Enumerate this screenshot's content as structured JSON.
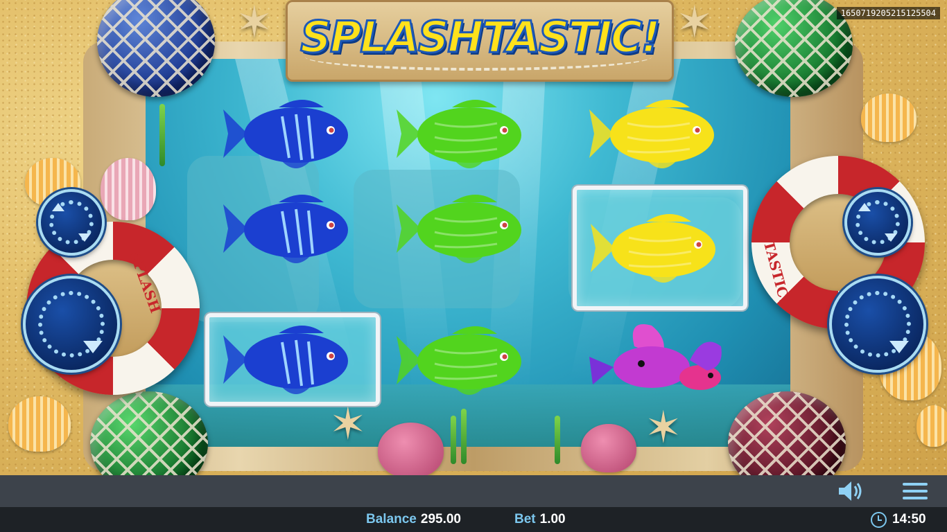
{
  "game": {
    "title": "SPLASHTASTIC!",
    "round_id": "1650719205215125504",
    "buoy_left_text": "SPLASH",
    "buoy_right_text": "TASTIC!"
  },
  "reels": [
    {
      "symbols": [
        "blue-fish",
        "blue-fish",
        "blue-fish"
      ],
      "highlighted": [
        false,
        false,
        true
      ]
    },
    {
      "symbols": [
        "green-fish",
        "green-fish",
        "green-fish"
      ],
      "highlighted": [
        false,
        false,
        false
      ]
    },
    {
      "symbols": [
        "yellow-fish",
        "yellow-fish",
        "purple-fish"
      ],
      "highlighted": [
        false,
        true,
        false
      ]
    }
  ],
  "colors": {
    "blue-fish": "#1b3fd0",
    "green-fish": "#52d41e",
    "yellow-fish": "#f7e21a",
    "purple-fish": "#c23ad1",
    "accent": "#7cc7ee"
  },
  "controls": {
    "sound_icon": "speaker-icon",
    "menu_icon": "hamburger-menu-icon",
    "reel_buttons": [
      "respin-reel-button",
      "spin-button"
    ]
  },
  "status": {
    "balance_label": "Balance",
    "balance_value": "295.00",
    "bet_label": "Bet",
    "bet_value": "1.00",
    "time": "14:50"
  }
}
